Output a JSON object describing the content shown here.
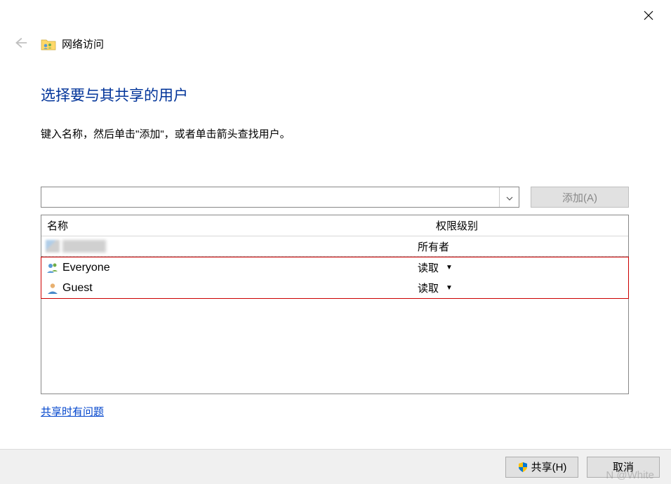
{
  "window": {
    "title": "网络访问"
  },
  "main": {
    "heading": "选择要与其共享的用户",
    "description": "键入名称，然后单击\"添加\"，或者单击箭头查找用户。",
    "add_button": "添加(A)",
    "help_link": "共享时有问题"
  },
  "table": {
    "columns": {
      "name": "名称",
      "permission": "权限级别"
    },
    "rows": [
      {
        "name": "",
        "permission": "所有者",
        "has_dropdown": false,
        "blurred": true
      },
      {
        "name": "Everyone",
        "permission": "读取",
        "has_dropdown": true,
        "icon": "group"
      },
      {
        "name": "Guest",
        "permission": "读取",
        "has_dropdown": true,
        "icon": "user"
      }
    ]
  },
  "footer": {
    "share": "共享(H)",
    "cancel": "取消"
  },
  "watermark": "N @White"
}
